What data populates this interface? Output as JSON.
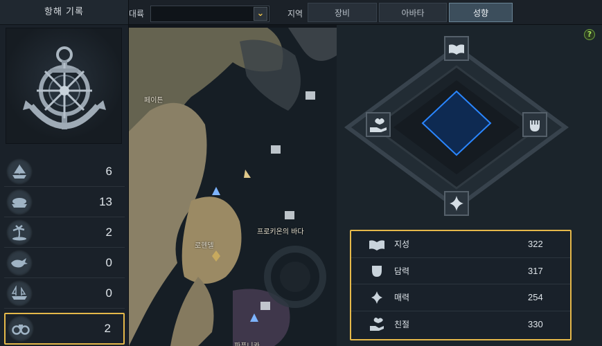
{
  "left_panel": {
    "title": "항해 기록",
    "emblem_icon": "anchor-wheel-icon",
    "stats": [
      {
        "icon": "sailing-ship-icon",
        "value": "6"
      },
      {
        "icon": "boat-icon",
        "value": "13"
      },
      {
        "icon": "island-palm-icon",
        "value": "2"
      },
      {
        "icon": "whale-icon",
        "value": "0"
      },
      {
        "icon": "ghost-ship-icon",
        "value": "0"
      },
      {
        "icon": "binoculars-icon",
        "value": "2"
      }
    ]
  },
  "topbar": {
    "continent_label": "대륙",
    "continent_value": "",
    "region_label": "지역",
    "tabs": [
      {
        "label": "장비",
        "active": false
      },
      {
        "label": "아바타",
        "active": false
      },
      {
        "label": "성향",
        "active": true
      }
    ]
  },
  "map": {
    "labels": {
      "pade": "페이튼",
      "rohendel": "로헨델",
      "sea": "프로키온의 바다",
      "bottom": "파푸니카"
    }
  },
  "right_panel": {
    "help_label": "?",
    "diagram_icons": [
      "book-icon",
      "fist-icon",
      "sparkle-icon",
      "heart-hand-icon"
    ],
    "attributes": [
      {
        "icon": "book-icon",
        "name": "지성",
        "value": "322"
      },
      {
        "icon": "fist-icon",
        "name": "담력",
        "value": "317"
      },
      {
        "icon": "sparkle-icon",
        "name": "매력",
        "value": "254"
      },
      {
        "icon": "heart-hand-icon",
        "name": "친절",
        "value": "330"
      }
    ]
  },
  "colors": {
    "highlight": "#e6b94a",
    "accent_blue": "#1e6fd6",
    "help_green": "#a6e25a"
  }
}
